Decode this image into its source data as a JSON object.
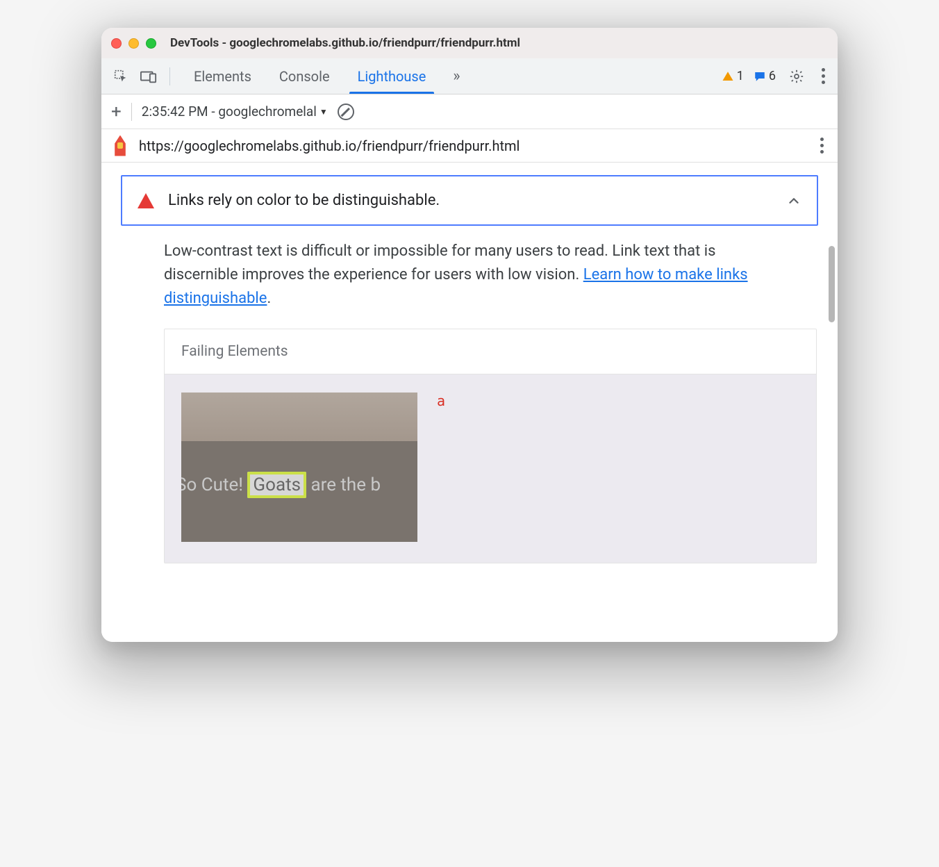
{
  "window": {
    "title": "DevTools - googlechromelabs.github.io/friendpurr/friendpurr.html"
  },
  "tabs": {
    "elements": "Elements",
    "console": "Console",
    "lighthouse": "Lighthouse"
  },
  "counters": {
    "warnings": "1",
    "messages": "6"
  },
  "subbar": {
    "report_label": "2:35:42 PM - googlechromelal"
  },
  "url": "https://googlechromelabs.github.io/friendpurr/friendpurr.html",
  "audit": {
    "title": "Links rely on color to be distinguishable.",
    "desc_pre": "Low-contrast text is difficult or impossible for many users to read. Link text that is discernible improves the experience for users with low vision. ",
    "learn_link": "Learn how to make links distinguishable",
    "desc_post": "."
  },
  "failing": {
    "heading": "Failing Elements",
    "element_tag": "a",
    "thumb_text_pre": "So Cute! ",
    "thumb_text_hl": "Goats",
    "thumb_text_post": " are the b"
  }
}
